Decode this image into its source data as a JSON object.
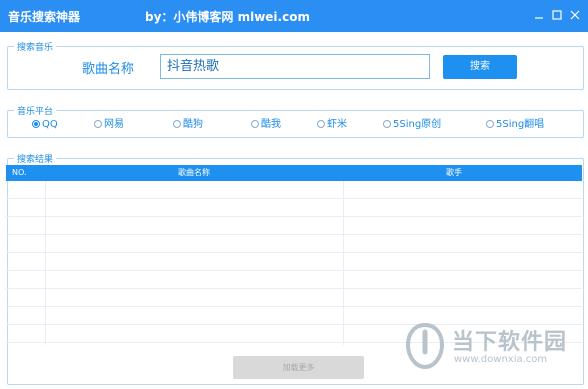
{
  "window": {
    "title": "音乐搜索神器",
    "byline": "by：小伟博客网 mlwei.com"
  },
  "search": {
    "group_label": "搜索音乐",
    "field_label": "歌曲名称",
    "input_value": "抖音热歌",
    "button_label": "搜索"
  },
  "platform": {
    "group_label": "音乐平台",
    "options": [
      {
        "label": "QQ",
        "selected": true
      },
      {
        "label": "网易",
        "selected": false
      },
      {
        "label": "酷狗",
        "selected": false
      },
      {
        "label": "酷我",
        "selected": false
      },
      {
        "label": "虾米",
        "selected": false
      },
      {
        "label": "5Sing原创",
        "selected": false
      },
      {
        "label": "5Sing翻唱",
        "selected": false
      }
    ]
  },
  "results": {
    "group_label": "搜索结果",
    "columns": [
      "NO.",
      "歌曲名称",
      "歌手"
    ],
    "rows": [],
    "load_more_label": "加载更多"
  },
  "watermark": {
    "text": "当下软件园",
    "url": "www.downxia.com"
  },
  "colors": {
    "accent": "#1e90f0",
    "titlebar": "#2a8ef2",
    "watermark": "#b8c3cc"
  }
}
